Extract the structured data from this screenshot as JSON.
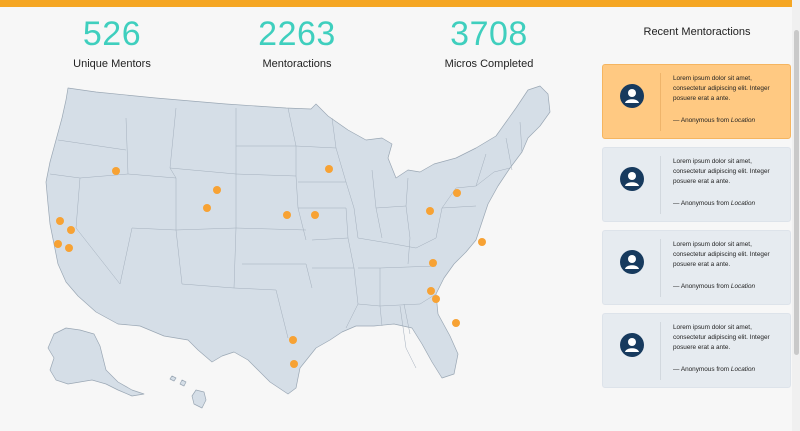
{
  "stats": [
    {
      "value": "526",
      "label": "Unique Mentors"
    },
    {
      "value": "2263",
      "label": "Mentoractions"
    },
    {
      "value": "3708",
      "label": "Micros Completed"
    }
  ],
  "recent": {
    "title": "Recent Mentoractions",
    "items": [
      {
        "text": "Lorem ipsum dolor sit amet, consectetur adipiscing elit. Integer posuere erat a ante.",
        "by": "— Anonymous from",
        "location": "Location"
      },
      {
        "text": "Lorem ipsum dolor sit amet, consectetur adipiscing elit. Integer posuere erat a ante.",
        "by": "— Anonymous from",
        "location": "Location"
      },
      {
        "text": "Lorem ipsum dolor sit amet, consectetur adipiscing elit. Integer posuere erat a ante.",
        "by": "— Anonymous from",
        "location": "Location"
      },
      {
        "text": "Lorem ipsum dolor sit amet, consectetur adipiscing elit. Integer posuere erat a ante.",
        "by": "— Anonymous from",
        "location": "Location"
      }
    ]
  },
  "colors": {
    "accent_bar": "#f5a623",
    "stat_number": "#3fcfbe",
    "map_fill": "#d5dee7",
    "map_border": "#9aa7b4",
    "marker": "#f7a234",
    "card_active": "#ffc982",
    "card": "#e6ebf0",
    "avatar": "#173a5e"
  },
  "icons": {
    "avatar": "user-avatar-icon",
    "marker": "location-marker"
  }
}
